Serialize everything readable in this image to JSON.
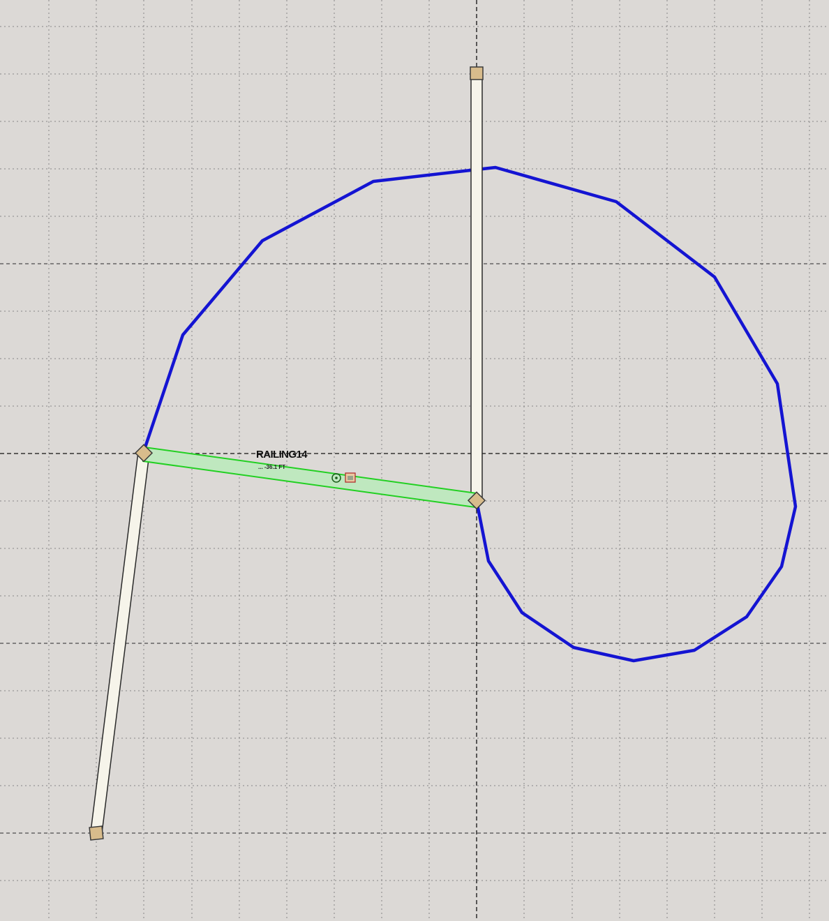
{
  "drawing": {
    "background_color": "#dcd9d6",
    "grid_color": "#555555",
    "curve_color": "#1414d2",
    "wall_fill": "#f6f4ea",
    "wall_stroke": "#2a2a2a",
    "handle_fill": "#d8bc8c",
    "handle_stroke": "#3a3a3a",
    "selected_fill": "#bfe8bf",
    "selected_stroke": "#22d022"
  },
  "selected_element": {
    "name": "RAILING14",
    "dimension_text": "... -36.1 FT",
    "origin_icon": "target-icon",
    "grip_icon": "square-grip-icon"
  }
}
